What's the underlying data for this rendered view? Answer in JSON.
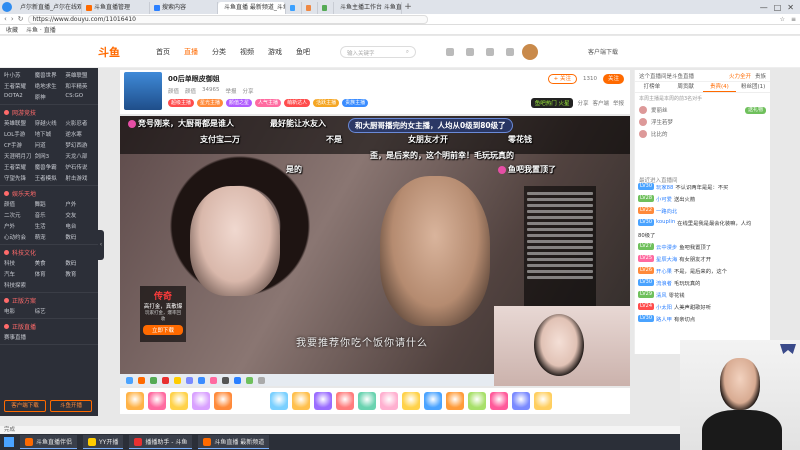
{
  "browser": {
    "tabs": [
      {
        "label": "卢尔新直播_卢尔在线观看_斗鱼",
        "color": "#ff6a00"
      },
      {
        "label": "斗鱼直播管理",
        "color": "#ff6a00"
      },
      {
        "label": "搜索内容",
        "color": "#2a7fff"
      },
      {
        "label": "斗鱼直播 最新频道_斗鱼",
        "color": "#ff6a00",
        "active": true
      },
      {
        "label": "",
        "color": "#3aa0ff"
      },
      {
        "label": "",
        "color": "#e84"
      },
      {
        "label": "",
        "color": "#5a5"
      },
      {
        "label": "斗鱼主播工作台 斗鱼直播",
        "color": "#ff6a00"
      }
    ],
    "url": "https://www.douyu.com/11016410",
    "bookmarks": [
      "收藏",
      "斗鱼 · 直播"
    ],
    "window_controls": [
      "—",
      "□",
      "✕"
    ]
  },
  "site": {
    "logo": "斗鱼",
    "nav": [
      "首页",
      "直播",
      "分类",
      "视频",
      "游戏",
      "鱼吧"
    ],
    "active_nav": "直播",
    "search_placeholder": "输入关键字",
    "download_label": "客户端下载"
  },
  "sidebar": {
    "sections": [
      {
        "title": "",
        "items": [
          "叶小苏",
          "魔兽世界",
          "英雄联盟",
          "王者荣耀",
          "绝地求生",
          "和平精英",
          "DOTA2",
          "原神",
          "CS:GO"
        ]
      },
      {
        "title": "网游竞技",
        "items": [
          "英雄联盟",
          "穿越火线",
          "火影忍者",
          "LOL手游",
          "地下城",
          "逆水寒",
          "CF手游",
          "问道",
          "梦幻西游",
          "天涯明月刀",
          "剑网3",
          "天龙八部",
          "王者荣耀",
          "魔兽争霸",
          "炉石传说",
          "守望先锋",
          "王者模拟",
          "射击游戏"
        ]
      },
      {
        "title": "娱乐天地",
        "items": [
          "颜值",
          "舞蹈",
          "户外",
          "二次元",
          "音乐",
          "交友",
          "户外",
          "生活",
          "电台",
          "心动约会",
          "萌宠",
          "数码"
        ]
      },
      {
        "title": "科技文化",
        "items": [
          "科技",
          "美食",
          "数码",
          "汽车",
          "体育",
          "教育",
          "科技探索"
        ]
      },
      {
        "title": "正版方案",
        "items": [
          "电影",
          "综艺"
        ]
      },
      {
        "title": "正版直播",
        "items": [
          "赛事直播"
        ]
      }
    ],
    "bottom_buttons": [
      "客户端下载",
      "斗鱼开播"
    ],
    "collapse_arrow": "‹"
  },
  "room": {
    "title": "00后单眼皮御姐",
    "meta": [
      "颜值",
      "颜值",
      "34965",
      "举报",
      "分享"
    ],
    "badges": [
      {
        "text": "超级主播",
        "color": "#ff4c4c"
      },
      {
        "text": "星光主播",
        "color": "#ff8a3a"
      },
      {
        "text": "颜值之星",
        "color": "#b05cff"
      },
      {
        "text": "人气主播",
        "color": "#ff6aa0"
      },
      {
        "text": "萌新达人",
        "color": "#ff4c4c"
      },
      {
        "text": "活跃主播",
        "color": "#f5a623"
      },
      {
        "text": "贵族主播",
        "color": "#3a8cff"
      }
    ],
    "follow_label": "+ 关注",
    "follower_count": "1310",
    "subscribe_label": "关注",
    "gift_promo": "鱼吧热门 火星",
    "extra_actions": [
      "分享",
      "客户端",
      "举报"
    ]
  },
  "video": {
    "danmu": [
      {
        "text": "竞号刚来，大厨哥都是谁人",
        "style": "normal"
      },
      {
        "text": "最好能让水友入",
        "style": "normal"
      },
      {
        "text": "和大厨哥播完的女主播，人均从0级到80级了",
        "style": "pill"
      },
      {
        "text": "支付宝二万",
        "style": "normal"
      },
      {
        "text": "不是",
        "style": "normal"
      },
      {
        "text": "女朋友才开",
        "style": "normal"
      },
      {
        "text": "零花钱",
        "style": "normal"
      },
      {
        "text": "歪，是后来的，这个明前幸！毛玩玩真的",
        "style": "normal"
      },
      {
        "text": "是的",
        "style": "normal"
      },
      {
        "text": "鱼吧我置顶了",
        "style": "normal"
      }
    ],
    "subtitle": "我要推荐你吃个饭你请什么",
    "promo": {
      "logo": "传奇",
      "line1": "高打金，真散爆",
      "line2": "玩家打金，爆率回收",
      "button": "立即下载"
    }
  },
  "gift_bar": {
    "gift_colors": [
      "#ffb347",
      "#ff6aa0",
      "#ffd24a",
      "#d9a1ff",
      "#ff8a3a",
      "#7ad0ff",
      "#ffc04d",
      "#9a6cff",
      "#ff7d7d",
      "#6ad3b0",
      "#ffb0d0",
      "#ffd24a",
      "#4aa3ff",
      "#ff9c3a",
      "#a8e06a",
      "#ff5a9a",
      "#7a8aff",
      "#ffcf60"
    ]
  },
  "right_panel": {
    "top_text": "这个直播间是斗鱼直播",
    "top_buttons": [
      "火力全开",
      "贵族"
    ],
    "tabs": [
      "打榜单",
      "周贡献",
      "贵宾(4)",
      "粉丝团(1)"
    ],
    "active_tab": "贵宾(4)",
    "rank_notice": "本周主播是本周的前3名对手",
    "rank_items": [
      {
        "name": "爱丽丝",
        "tag": "送礼物"
      },
      {
        "name": "浮生若梦",
        "tag": ""
      },
      {
        "name": "比比的",
        "tag": ""
      }
    ],
    "chat_header": "最近进入直播间",
    "chat": [
      {
        "lvl": "LV30",
        "lvl_color": "#4aa3ff",
        "name": "玩家88",
        "text": "不认识两年是是：不买"
      },
      {
        "lvl": "LV28",
        "lvl_color": "#6fc05c",
        "name": "小可爱",
        "text": "送出火箭"
      },
      {
        "lvl": "LV22",
        "lvl_color": "#ff8a3a",
        "name": "一路向北",
        "text": ""
      },
      {
        "lvl": "LV30",
        "lvl_color": "#4aa3ff",
        "name": "kouplin",
        "text": "在线里是我是最会化装嘛，人均"
      },
      {
        "lvl": "",
        "lvl_color": "#999",
        "name": "",
        "text": "80级了"
      },
      {
        "lvl": "LV27",
        "lvl_color": "#6fc05c",
        "name": "云中漫步",
        "text": "鱼吧我置顶了"
      },
      {
        "lvl": "LV25",
        "lvl_color": "#ff6aa0",
        "name": "星辰大海",
        "text": "有女朋友才开"
      },
      {
        "lvl": "LV26",
        "lvl_color": "#ff8a3a",
        "name": "开心果",
        "text": "不是，是后来的，这个"
      },
      {
        "lvl": "LV30",
        "lvl_color": "#4aa3ff",
        "name": "流浪者",
        "text": "毛玩玩真的"
      },
      {
        "lvl": "LV29",
        "lvl_color": "#6fc05c",
        "name": "清风",
        "text": "零花钱"
      },
      {
        "lvl": "LV24",
        "lvl_color": "#ff4c4c",
        "name": "小太阳",
        "text": "人美声甜歌好听"
      },
      {
        "lvl": "LV30",
        "lvl_color": "#4aa3ff",
        "name": "路人甲",
        "text": "有亲切点"
      }
    ]
  },
  "taskbar": {
    "status": "完成",
    "apps": [
      {
        "label": "斗鱼直播伴侣",
        "color": "#ff6a00"
      },
      {
        "label": "YY开播",
        "color": "#ffcc00"
      },
      {
        "label": "播播助手 - 斗鱼",
        "color": "#e83030"
      },
      {
        "label": "斗鱼直播 最新频道",
        "color": "#ff6a00"
      }
    ]
  }
}
